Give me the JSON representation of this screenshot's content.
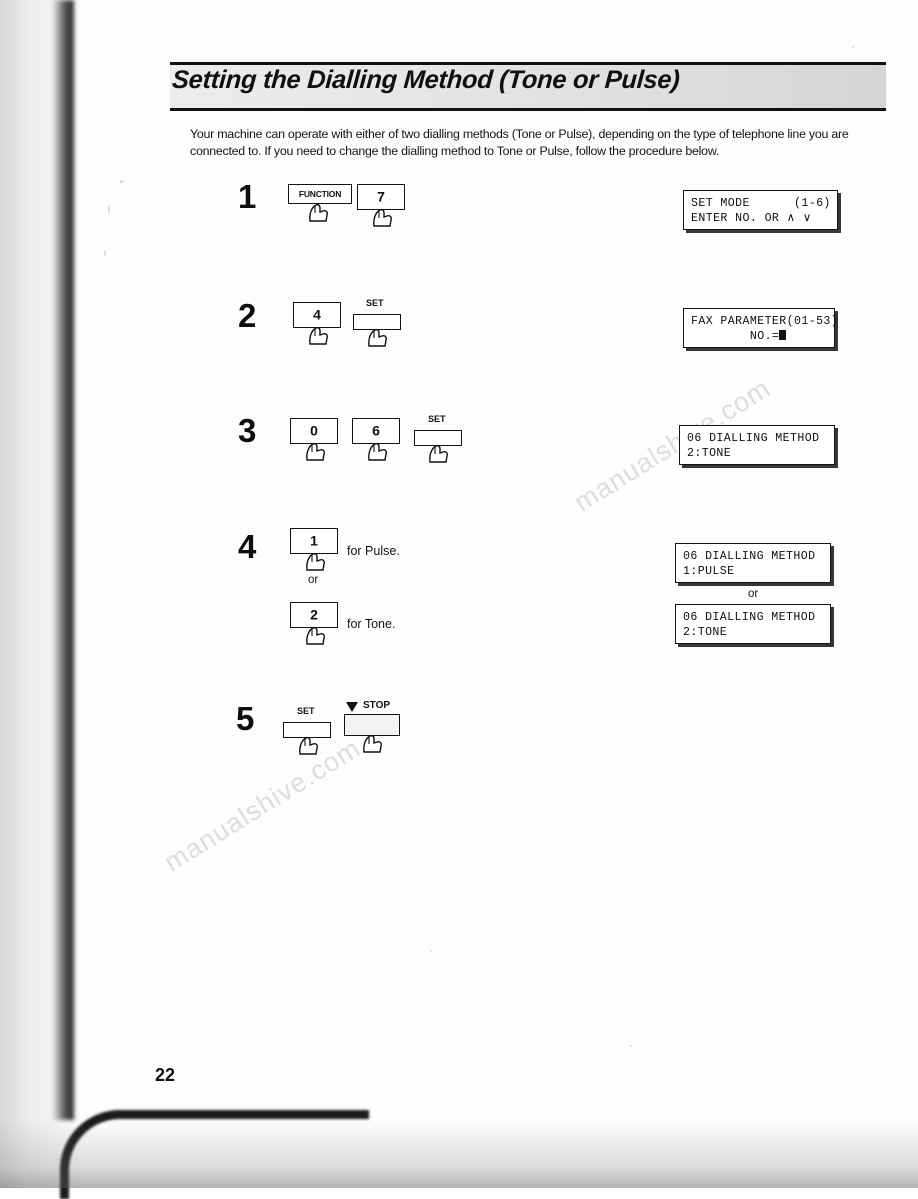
{
  "document": {
    "title": "Setting the Dialling Method (Tone or Pulse)",
    "intro": "Your machine can operate with either of two dialling methods (Tone or Pulse), depending on the type of telephone line you are connected to.  If you need to change the dialling method to Tone or Pulse, follow the procedure below.",
    "page_number": "22",
    "watermark": "manualshive.com"
  },
  "steps": [
    {
      "number": "1",
      "keys": [
        {
          "label": "FUNCTION",
          "type": "wide"
        },
        {
          "label": "7",
          "type": "num"
        }
      ],
      "display": {
        "line1": "SET MODE      (1-6)",
        "line2": "ENTER NO. OR ∧ ∨"
      }
    },
    {
      "number": "2",
      "keys": [
        {
          "label": "4",
          "type": "num"
        },
        {
          "label": "SET",
          "type": "small"
        }
      ],
      "display": {
        "line1": "FAX PARAMETER(01-53)",
        "line2": "        NO.="
      }
    },
    {
      "number": "3",
      "keys": [
        {
          "label": "0",
          "type": "num"
        },
        {
          "label": "6",
          "type": "num"
        },
        {
          "label": "SET",
          "type": "small"
        }
      ],
      "display": {
        "line1": "06 DIALLING METHOD",
        "line2": "2:TONE"
      }
    },
    {
      "number": "4",
      "keys": [
        {
          "label": "1",
          "type": "num"
        },
        {
          "label": "2",
          "type": "num"
        }
      ],
      "caption_pulse": "for Pulse.",
      "caption_tone": "for Tone.",
      "or_label": "or",
      "display_pulse": {
        "line1": "06 DIALLING METHOD",
        "line2": "1:PULSE"
      },
      "display_or": "or",
      "display_tone": {
        "line1": "06 DIALLING METHOD",
        "line2": "2:TONE"
      }
    },
    {
      "number": "5",
      "keys": [
        {
          "label": "SET",
          "type": "small"
        },
        {
          "label": "STOP",
          "type": "stop"
        }
      ]
    }
  ]
}
